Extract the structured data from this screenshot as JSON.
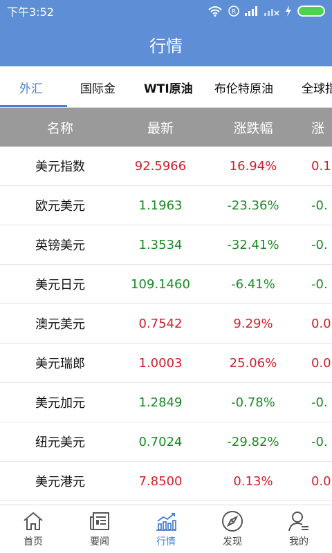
{
  "status_bar": {
    "time": "下午3:52"
  },
  "app_bar": {
    "title": "行情"
  },
  "tabs": [
    {
      "label": "外汇",
      "active": true
    },
    {
      "label": "国际金"
    },
    {
      "label": "WTI原油"
    },
    {
      "label": "布伦特原油"
    },
    {
      "label": "全球指"
    }
  ],
  "table": {
    "headers": [
      "名称",
      "最新",
      "涨跌幅",
      "涨"
    ],
    "rows": [
      {
        "name": "美元指数",
        "latest": "92.5966",
        "change_pct": "16.94%",
        "extra": "0.1",
        "trend": "up"
      },
      {
        "name": "欧元美元",
        "latest": "1.1963",
        "change_pct": "-23.36%",
        "extra": "-0.",
        "trend": "down"
      },
      {
        "name": "英镑美元",
        "latest": "1.3534",
        "change_pct": "-32.41%",
        "extra": "-0.",
        "trend": "down"
      },
      {
        "name": "美元日元",
        "latest": "109.1460",
        "change_pct": "-6.41%",
        "extra": "-0.",
        "trend": "down"
      },
      {
        "name": "澳元美元",
        "latest": "0.7542",
        "change_pct": "9.29%",
        "extra": "0.0",
        "trend": "up"
      },
      {
        "name": "美元瑞郎",
        "latest": "1.0003",
        "change_pct": "25.06%",
        "extra": "0.0",
        "trend": "up"
      },
      {
        "name": "美元加元",
        "latest": "1.2849",
        "change_pct": "-0.78%",
        "extra": "-0.",
        "trend": "down"
      },
      {
        "name": "纽元美元",
        "latest": "0.7024",
        "change_pct": "-29.82%",
        "extra": "-0.",
        "trend": "down"
      },
      {
        "name": "美元港元",
        "latest": "7.8500",
        "change_pct": "0.13%",
        "extra": "0.0",
        "trend": "up"
      }
    ]
  },
  "bottom_nav": [
    {
      "label": "首页",
      "icon": "home-icon"
    },
    {
      "label": "要闻",
      "icon": "news-icon"
    },
    {
      "label": "行情",
      "icon": "market-chart-icon",
      "active": true
    },
    {
      "label": "发现",
      "icon": "compass-icon"
    },
    {
      "label": "我的",
      "icon": "user-icon"
    }
  ],
  "colors": {
    "primary": "#5e8fd6",
    "accent": "#4a82d3",
    "up": "#d0202a",
    "down": "#1a8a23",
    "table_header_bg": "#9a9a9a"
  }
}
